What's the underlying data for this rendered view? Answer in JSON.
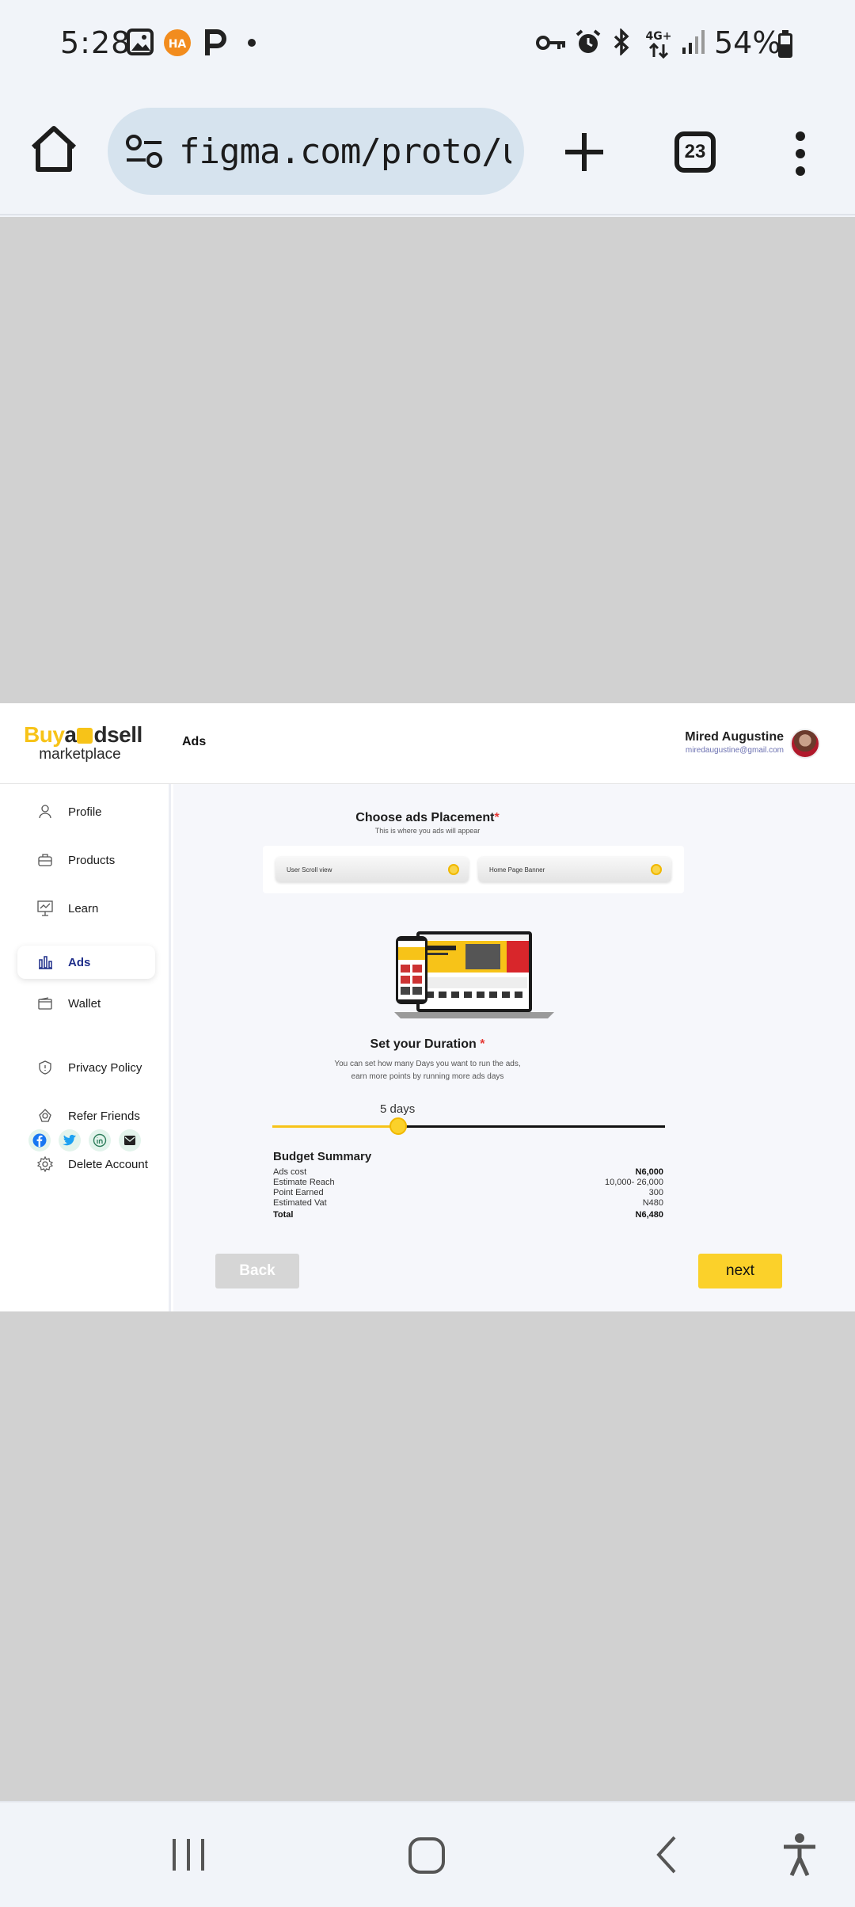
{
  "status_bar": {
    "time": "5:28",
    "battery": "54%",
    "network": "4G+"
  },
  "browser": {
    "url": "figma.com/proto/uYY",
    "tab_count": "23"
  },
  "header": {
    "logo_buy": "Buy",
    "logo_a": "a",
    "logo_dsell": "dsell",
    "logo_sub": "marketplace",
    "title": "Ads",
    "user_name": "Mired Augustine",
    "user_email": "miredaugustine@gmail.com"
  },
  "sidebar": {
    "items": [
      {
        "label": "Profile",
        "icon": "person-icon"
      },
      {
        "label": "Products",
        "icon": "briefcase-icon"
      },
      {
        "label": "Learn",
        "icon": "presentation-icon"
      },
      {
        "label": "Ads",
        "icon": "bar-chart-icon",
        "active": true
      },
      {
        "label": "Wallet",
        "icon": "wallet-icon"
      },
      {
        "label": "Privacy Policy",
        "icon": "shield-icon"
      },
      {
        "label": "Refer Friends",
        "icon": "refer-icon"
      },
      {
        "label": "Delete Account",
        "icon": "gear-icon"
      }
    ],
    "socials": [
      "facebook-icon",
      "twitter-icon",
      "linkedin-icon",
      "mail-icon"
    ]
  },
  "placement": {
    "title": "Choose ads  Placement",
    "required": "*",
    "subtitle": "This is where you ads will appear",
    "options": [
      "User Scroll view",
      "Home Page Banner"
    ]
  },
  "duration": {
    "title": "Set your Duration",
    "required": "*",
    "desc_line1": "You  can set how many Days you want to run the ads,",
    "desc_line2": "earn more points by running more ads days",
    "value_label": "5 days",
    "slider_fraction": 0.32
  },
  "budget": {
    "title": "Budget Summary",
    "rows": [
      {
        "label": "Ads cost",
        "value": "N6,000",
        "bold_value": true
      },
      {
        "label": "Estimate Reach",
        "value": "10,000- 26,000"
      },
      {
        "label": "Point Earned",
        "value": "300"
      },
      {
        "label": "Estimated Vat",
        "value": "N480"
      },
      {
        "label": "Total",
        "value": "N6,480",
        "bold": true
      }
    ]
  },
  "actions": {
    "back": "Back",
    "next": "next"
  },
  "colors": {
    "accent": "#FBD12A",
    "active_nav": "#1F2E8A",
    "required": "#E53935"
  }
}
